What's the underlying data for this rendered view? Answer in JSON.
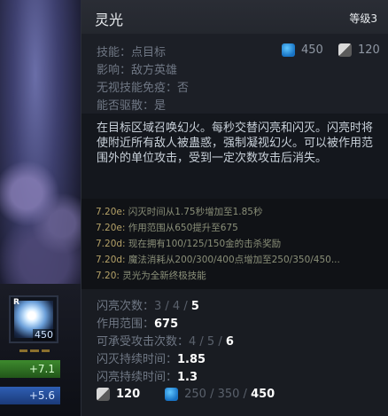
{
  "hud": {
    "hotkey": "R",
    "ability_mana": "450",
    "hp_regen": "+7.1",
    "mp_regen": "+5.6"
  },
  "tooltip": {
    "title": "灵光",
    "level_label": "等级3",
    "meta": {
      "target": "技能：点目标",
      "affects": "影响：敌方英雄",
      "spell_immunity": "无视技能免疫：否",
      "dispellable": "能否驱散：是"
    },
    "header_cost": {
      "mana": "450",
      "cooldown": "120"
    },
    "description": "在目标区域召唤幻火。每秒交替闪亮和闪灭。闪亮时将使附近所有敌人被蛊惑，强制凝视幻火。可以被作用范围外的单位攻击，受到一定次数攻击后消失。",
    "notes": [
      {
        "ver": "7.20e:",
        "text": " 闪灭时间从1.75秒增加至1.85秒"
      },
      {
        "ver": "7.20e:",
        "text": " 作用范围从650提升至675"
      },
      {
        "ver": "7.20d:",
        "text": " 现在拥有100/125/150金的击杀奖励"
      },
      {
        "ver": "7.20d:",
        "text": " 魔法消耗从200/300/400点增加至250/350/450..."
      },
      {
        "ver": "7.20:",
        "text": " 灵光为全新终极技能"
      }
    ],
    "stats": {
      "flashes": {
        "label": "闪亮次数：",
        "dim": "3 / 4 / ",
        "cur": "5"
      },
      "radius": {
        "label": "作用范围：",
        "dim": "",
        "cur": "675"
      },
      "hits": {
        "label": "可承受攻击次数：",
        "dim": "4 / 5 / ",
        "cur": "6"
      },
      "dark_duration": {
        "label": "闪灭持续时间：",
        "dim": "",
        "cur": "1.85"
      },
      "flash_duration": {
        "label": "闪亮持续时间：",
        "dim": "",
        "cur": "1.3"
      }
    },
    "bottom_cost": {
      "cooldown": "120",
      "mana_dim": "250 / 350 / ",
      "mana_cur": "450"
    }
  },
  "colors": {
    "accent_mana": "#1873c4",
    "note_version": "#b4a167",
    "tooltip_bg": "#1a1d24"
  }
}
